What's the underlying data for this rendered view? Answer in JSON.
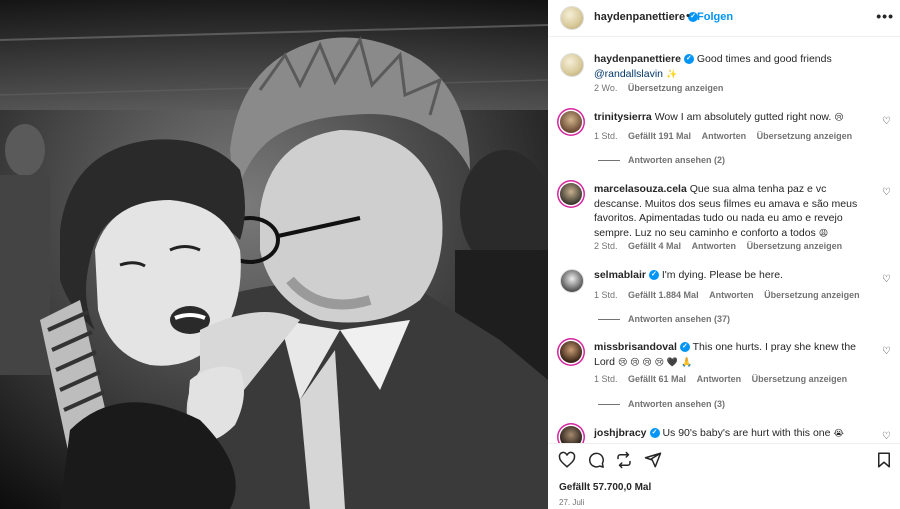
{
  "post": {
    "username": "haydenpanettiere",
    "follow_label": "Folgen",
    "dot": "•",
    "more": "•••",
    "caption_text": "Good times and good friends",
    "caption_mention": "@randallslavin",
    "caption_emoji": "✨",
    "caption_age": "2 Wo.",
    "caption_translate": "Übersetzung anzeigen",
    "likes": "Gefällt 57.700,0 Mal",
    "date": "27. Juli"
  },
  "comments": [
    {
      "username": "trinitysierra",
      "verified": false,
      "text": "Wow I am absolutely gutted right now.",
      "emoji": "😢",
      "time": "1 Std.",
      "likes": "Gefällt 191 Mal",
      "reply": "Antworten",
      "translate": "Übersetzung anzeigen",
      "replies": "Antworten ansehen (2)"
    },
    {
      "username": "marcelasouza.cela",
      "verified": false,
      "text": "Que sua alma tenha paz e vc descanse. Muitos dos seus filmes eu amava e são meus favoritos. Apimentadas tudo ou nada eu amo e revejo sempre. Luz no seu caminho e conforto a todos",
      "emoji": "😩",
      "time": "2 Std.",
      "likes": "Gefällt 4 Mal",
      "reply": "Antworten",
      "translate": "Übersetzung anzeigen",
      "replies": ""
    },
    {
      "username": "selmablair",
      "verified": true,
      "text": "I'm dying. Please be here.",
      "emoji": "",
      "time": "1 Std.",
      "likes": "Gefällt 1.884 Mal",
      "reply": "Antworten",
      "translate": "Übersetzung anzeigen",
      "replies": "Antworten ansehen (37)"
    },
    {
      "username": "missbrisandoval",
      "verified": true,
      "text": "This one hurts. I pray she knew the Lord",
      "emoji": "😢 😢 😢 😢 🖤 🙏",
      "time": "1 Std.",
      "likes": "Gefällt 61 Mal",
      "reply": "Antworten",
      "translate": "Übersetzung anzeigen",
      "replies": "Antworten ansehen (3)"
    },
    {
      "username": "joshjbracy",
      "verified": true,
      "text": "Us 90's baby's are hurt with this one",
      "emoji": "😭",
      "time": "",
      "likes": "",
      "reply": "",
      "translate": "",
      "replies": ""
    }
  ],
  "icons": {
    "like": "heart-icon",
    "comment": "comment-icon",
    "share": "repost-icon",
    "send": "send-icon",
    "save": "bookmark-icon"
  },
  "colors": {
    "accent": "#0095f6",
    "text": "#262626",
    "muted": "#737373",
    "mention": "#00376b"
  }
}
